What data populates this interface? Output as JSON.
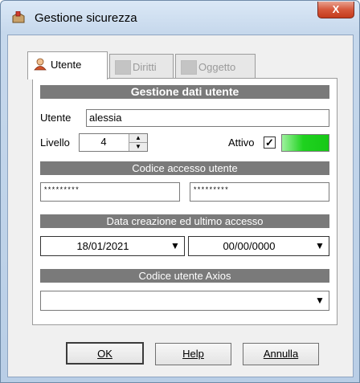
{
  "window": {
    "title": "Gestione sicurezza",
    "close_label": "X"
  },
  "tabs": [
    {
      "label": "Utente",
      "active": true
    },
    {
      "label": "Diritti",
      "active": false
    },
    {
      "label": "Oggetto",
      "active": false
    }
  ],
  "user_section": {
    "header": "Gestione dati utente",
    "utente_label": "Utente",
    "utente_value": "alessia",
    "livello_label": "Livello",
    "livello_value": "4",
    "attivo_label": "Attivo",
    "attivo_checked": "✓",
    "attivo_color": "#1fd21f"
  },
  "access_code": {
    "header": "Codice accesso utente",
    "password": "*********",
    "password_confirm": "*********"
  },
  "dates": {
    "header": "Data creazione ed ultimo accesso",
    "creation_date": "18/01/2021",
    "last_access": "00/00/0000"
  },
  "axios": {
    "header": "Codice utente Axios",
    "value": ""
  },
  "buttons": {
    "ok": "OK",
    "help": "Help",
    "cancel": "Annulla"
  }
}
